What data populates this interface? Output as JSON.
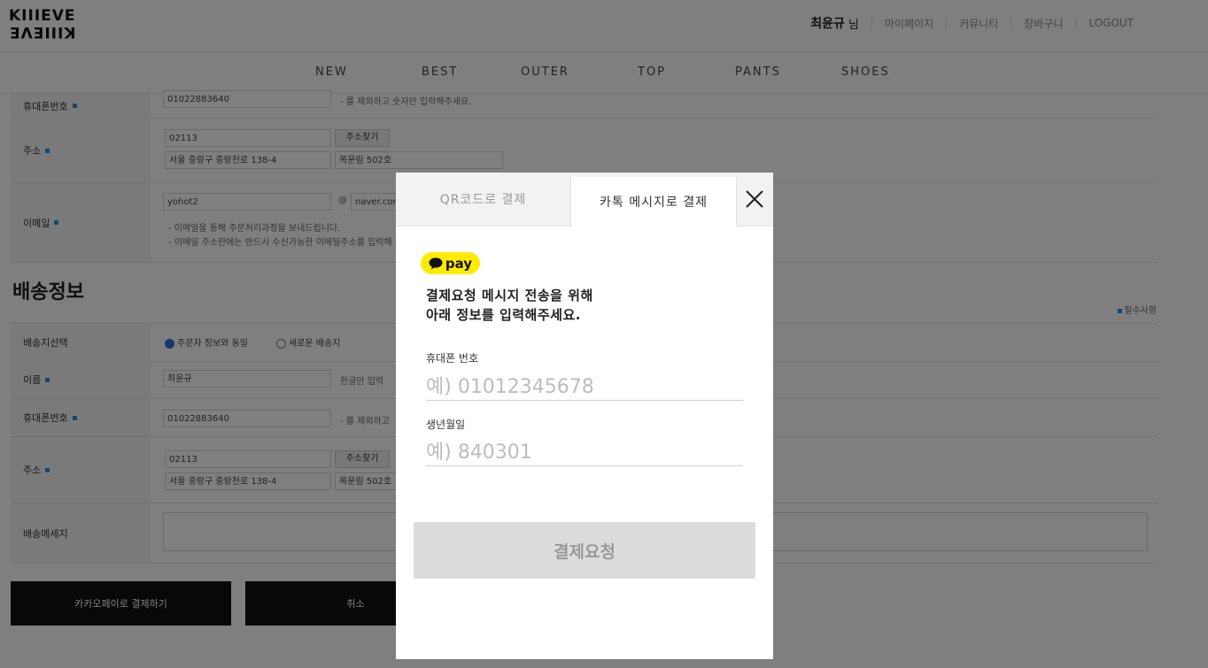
{
  "header": {
    "logo_top": "KIIIEVE",
    "logo_bottom": "KIIIEVE",
    "user_name": "최윤규",
    "user_suffix": "님",
    "links": [
      "마이페이지",
      "커뮤니티",
      "장바구니",
      "LOGOUT"
    ]
  },
  "nav": [
    "NEW",
    "BEST",
    "OUTER",
    "TOP",
    "PANTS",
    "SHOES"
  ],
  "orderer": {
    "phone_label": "휴대폰번호",
    "phone_value": "01022883640",
    "phone_help": "- 를 제외하고 숫자만 입력해주세요.",
    "address_label": "주소",
    "zipcode": "02113",
    "zip_button": "주소찾기",
    "address1": "서울 중랑구 중랑천로 138-4",
    "address2": "목운림 502호",
    "email_label": "이메일",
    "email_id": "yohot2",
    "email_at": "@",
    "email_domain": "naver.com",
    "email_help1": "- 이메일을 통해 주문처리과정을 보내드립니다.",
    "email_help2": "- 이메일 주소란에는 반드시 수신가능한 이메일주소를 입력해 주세요"
  },
  "shipping": {
    "title": "배송정보",
    "required_note": "필수사항",
    "select_label": "배송지선택",
    "option_same": "주문자 정보와 동일",
    "option_new": "새로운 배송지",
    "name_label": "이름",
    "name_value": "최윤규",
    "name_help": "한글만 입력",
    "phone_label": "휴대폰번호",
    "phone_value": "01022883640",
    "phone_help": "- 를 제외하고",
    "address_label": "주소",
    "zipcode": "02113",
    "zip_button": "주소찾기",
    "address1": "서울 중랑구 중랑천로 138-4",
    "address2": "목운림 502호",
    "message_label": "배송메세지"
  },
  "actions": {
    "pay_button": "카카오페이로 결제하기",
    "cancel_button": "취소"
  },
  "modal": {
    "tab_qr": "QR코드로 결제",
    "tab_message": "카톡 메시지로 결제",
    "badge_text": "pay",
    "intro_line1": "결제요청 메시지 전송을 위해",
    "intro_line2": "아래 정보를 입력해주세요.",
    "phone_label": "휴대폰 번호",
    "phone_placeholder": "예) 01012345678",
    "birth_label": "생년월일",
    "birth_placeholder": "예) 840301",
    "submit_label": "결제요청"
  },
  "colors": {
    "kakao_yellow": "#ffeb00",
    "accent_blue": "#2f8fd8",
    "overlay": "rgba(0,0,0,0.5)"
  }
}
